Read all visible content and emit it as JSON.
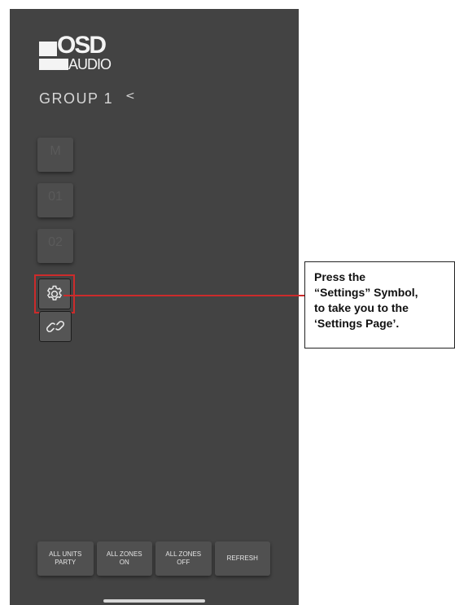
{
  "logo": {
    "brand_line1": "OSD",
    "brand_line2": "AUDIO"
  },
  "header": {
    "group_title": "GROUP 1",
    "back_glyph": "<"
  },
  "zones": [
    {
      "code": "M",
      "sub": ""
    },
    {
      "code": "01",
      "sub": ""
    },
    {
      "code": "02",
      "sub": ""
    }
  ],
  "icons": {
    "settings": "gear-icon",
    "link": "link-icon"
  },
  "bottom_bar": [
    {
      "line1": "ALL UNITS",
      "line2": "PARTY"
    },
    {
      "line1": "ALL ZONES",
      "line2": "ON"
    },
    {
      "line1": "ALL ZONES",
      "line2": "OFF"
    },
    {
      "line1": "REFRESH",
      "line2": ""
    }
  ],
  "callout": {
    "text": "Press the\n“Settings” Symbol,\nto take you to the\n‘Settings Page’."
  },
  "colors": {
    "app_background": "#434343",
    "highlight": "#cc2b2b",
    "button": "#505050",
    "text_light": "#e4e4e4"
  }
}
